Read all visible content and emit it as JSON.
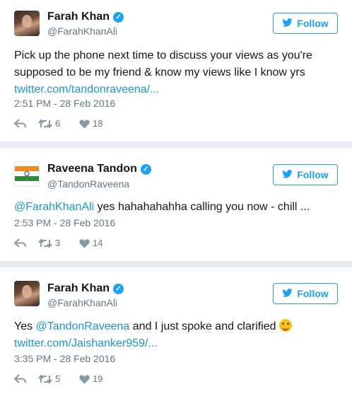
{
  "tweets": [
    {
      "name": "Farah Khan",
      "handle": "@FarahKhanAli",
      "follow_label": "Follow",
      "text_plain": "Pick up the phone next time to discuss your views as you're supposed to be my friend & know my views like I know yrs",
      "link": "twitter.com/tandonraveena/...",
      "time": "2:51 PM - 28 Feb 2016",
      "retweets": "6",
      "likes": "18"
    },
    {
      "name": "Raveena Tandon",
      "handle": "@TandonRaveena",
      "follow_label": "Follow",
      "mention": "@FarahKhanAli",
      "text_plain": " yes hahahahahha calling you now - chill ...",
      "time": "2:53 PM - 28 Feb 2016",
      "retweets": "3",
      "likes": "14"
    },
    {
      "name": "Farah Khan",
      "handle": "@FarahKhanAli",
      "follow_label": "Follow",
      "text_before": "Yes ",
      "mention": "@TandonRaveena",
      "text_after": " and I just spoke and clarified ",
      "link": "twitter.com/Jaishanker959/...",
      "time": "3:35 PM - 28 Feb 2016",
      "retweets": "5",
      "likes": "19"
    }
  ],
  "icons": [
    "bird-icon",
    "verified-icon",
    "reply-icon",
    "retweet-icon",
    "heart-icon",
    "smiling-emoji-icon"
  ],
  "colors": {
    "accent": "#1da1f2",
    "link": "#1b95e0",
    "muted": "#657786"
  }
}
